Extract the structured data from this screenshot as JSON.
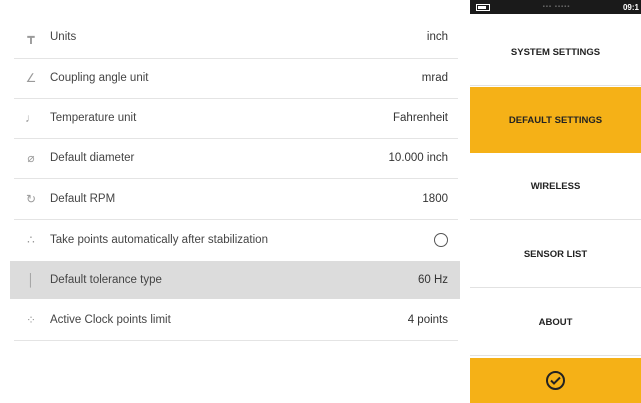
{
  "settings": [
    {
      "icon": "units-icon",
      "glyph": "┳",
      "label": "Units",
      "value": "inch"
    },
    {
      "icon": "coupling-angle-icon",
      "glyph": "∠",
      "label": "Coupling angle unit",
      "value": "mrad"
    },
    {
      "icon": "thermometer-icon",
      "glyph": "♩",
      "label": "Temperature unit",
      "value": "Fahrenheit"
    },
    {
      "icon": "diameter-icon",
      "glyph": "⌀",
      "label": "Default diameter",
      "value": "10.000 inch"
    },
    {
      "icon": "rpm-icon",
      "glyph": "↻",
      "label": "Default RPM",
      "value": "1800"
    },
    {
      "icon": "stabilization-icon",
      "glyph": "∴",
      "label": "Take points automatically after stabilization",
      "value": ""
    },
    {
      "icon": "tolerance-icon",
      "glyph": "│",
      "label": "Default tolerance type",
      "value": "60 Hz"
    },
    {
      "icon": "clock-points-icon",
      "glyph": "⁘",
      "label": "Active Clock points limit",
      "value": "4 points"
    }
  ],
  "statusbar": {
    "time": "09:1"
  },
  "nav": [
    {
      "label": "SYSTEM SETTINGS",
      "active": false
    },
    {
      "label": "DEFAULT SETTINGS",
      "active": true
    },
    {
      "label": "WIRELESS",
      "active": false
    },
    {
      "label": "SENSOR LIST",
      "active": false
    },
    {
      "label": "ABOUT",
      "active": false
    }
  ]
}
